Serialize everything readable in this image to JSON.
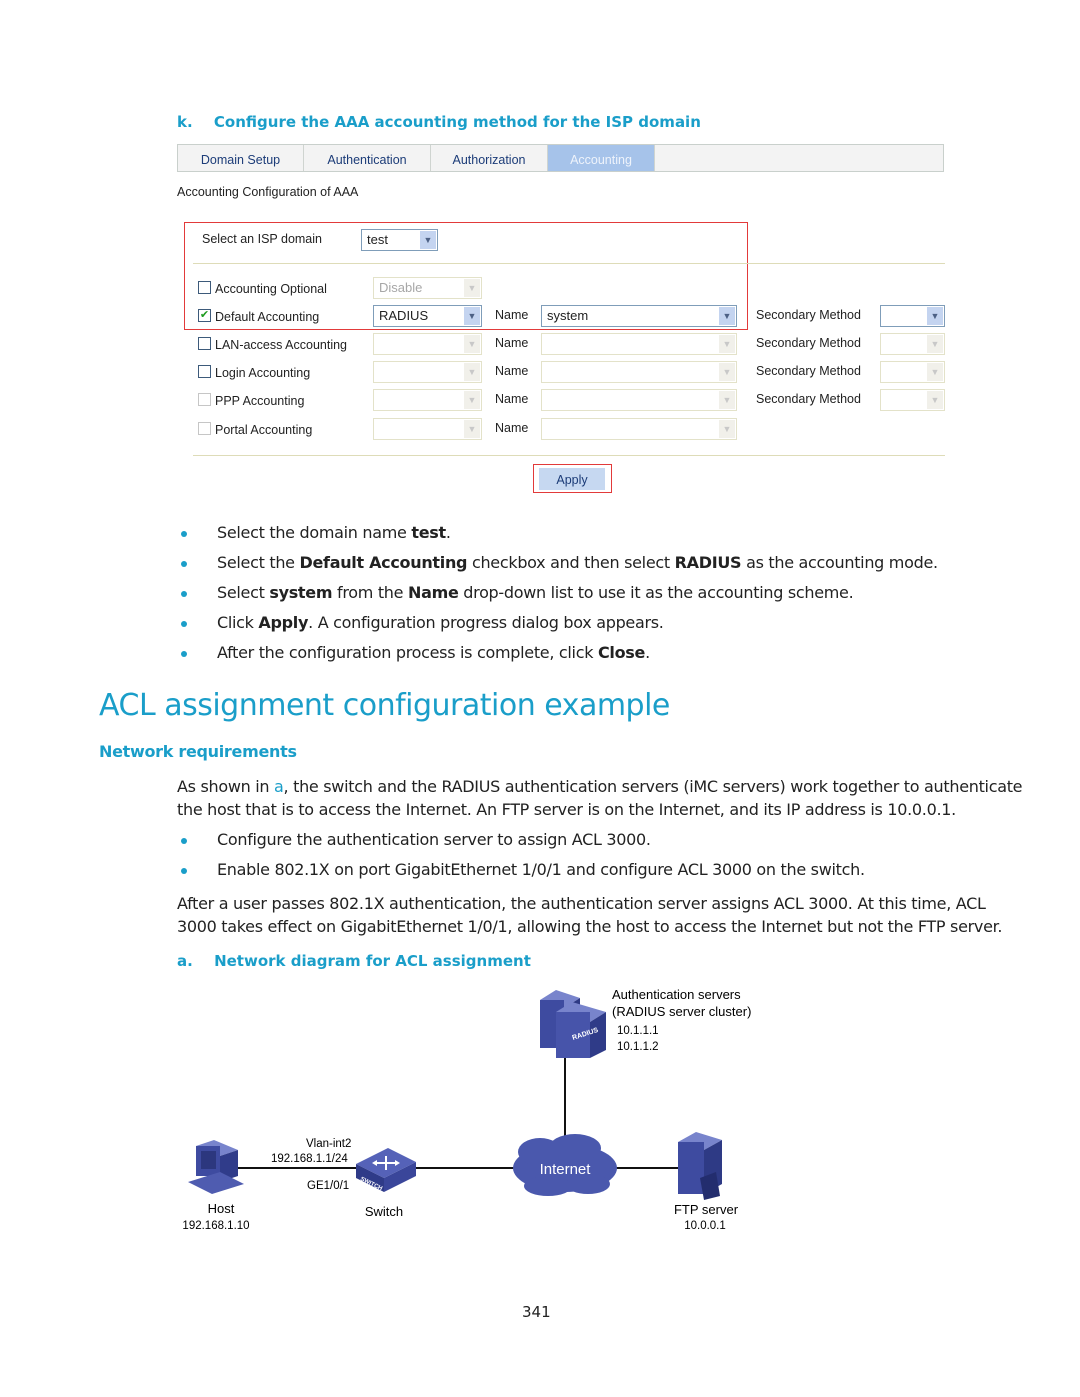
{
  "caption_k": {
    "label": "k.",
    "text": "Configure the AAA accounting method for the ISP domain"
  },
  "tabs": [
    {
      "label": "Domain Setup",
      "active": false
    },
    {
      "label": "Authentication",
      "active": false
    },
    {
      "label": "Authorization",
      "active": false
    },
    {
      "label": "Accounting",
      "active": true
    }
  ],
  "section_title": "Accounting Configuration of AAA",
  "isp_domain": {
    "label": "Select an ISP domain",
    "value": "test"
  },
  "rows": [
    {
      "label": "Accounting Optional",
      "checked": false,
      "enabled": true,
      "method": "Disable",
      "method_enabled": false,
      "has_name": false,
      "name_label": "",
      "name_value": "",
      "has_secondary": false,
      "secondary_label": "",
      "secondary_value": ""
    },
    {
      "label": "Default Accounting",
      "checked": true,
      "enabled": true,
      "method": "RADIUS",
      "method_enabled": true,
      "has_name": true,
      "name_label": "Name",
      "name_value": "system",
      "name_enabled": true,
      "has_secondary": true,
      "secondary_label": "Secondary Method",
      "secondary_value": "",
      "secondary_enabled": true
    },
    {
      "label": "LAN-access Accounting",
      "checked": false,
      "enabled": true,
      "method": "",
      "method_enabled": false,
      "has_name": true,
      "name_label": "Name",
      "name_value": "",
      "name_enabled": false,
      "has_secondary": true,
      "secondary_label": "Secondary Method",
      "secondary_value": "",
      "secondary_enabled": false
    },
    {
      "label": "Login Accounting",
      "checked": false,
      "enabled": true,
      "method": "",
      "method_enabled": false,
      "has_name": true,
      "name_label": "Name",
      "name_value": "",
      "name_enabled": false,
      "has_secondary": true,
      "secondary_label": "Secondary Method",
      "secondary_value": "",
      "secondary_enabled": false
    },
    {
      "label": "PPP Accounting",
      "checked": false,
      "enabled": false,
      "method": "",
      "method_enabled": false,
      "has_name": true,
      "name_label": "Name",
      "name_value": "",
      "name_enabled": false,
      "has_secondary": true,
      "secondary_label": "Secondary Method",
      "secondary_value": "",
      "secondary_enabled": false
    },
    {
      "label": "Portal Accounting",
      "checked": false,
      "enabled": false,
      "method": "",
      "method_enabled": false,
      "has_name": true,
      "name_label": "Name",
      "name_value": "",
      "name_enabled": false,
      "has_secondary": false,
      "secondary_label": "",
      "secondary_value": ""
    }
  ],
  "apply_label": "Apply",
  "steps": [
    [
      {
        "t": "Select the domain name "
      },
      {
        "t": "test",
        "b": true
      },
      {
        "t": "."
      }
    ],
    [
      {
        "t": "Select the "
      },
      {
        "t": "Default Accounting",
        "b": true
      },
      {
        "t": " checkbox and then select "
      },
      {
        "t": "RADIUS",
        "b": true
      },
      {
        "t": " as the accounting mode."
      }
    ],
    [
      {
        "t": "Select "
      },
      {
        "t": "system",
        "b": true
      },
      {
        "t": " from the "
      },
      {
        "t": "Name",
        "b": true
      },
      {
        "t": " drop-down list to use it as the accounting scheme."
      }
    ],
    [
      {
        "t": "Click "
      },
      {
        "t": "Apply",
        "b": true
      },
      {
        "t": ". A configuration progress dialog box appears."
      }
    ],
    [
      {
        "t": "After the configuration process is complete, click "
      },
      {
        "t": "Close",
        "b": true
      },
      {
        "t": "."
      }
    ]
  ],
  "heading": "ACL assignment configuration example",
  "subheading": "Network requirements",
  "para1": {
    "line1_pre": "As shown in ",
    "line1_link": "a",
    "line1_post": ", the switch and the RADIUS authentication servers (iMC servers) work together to authenticate",
    "line2": "the host that is to access the Internet. An FTP server is on the Internet, and its IP address is 10.0.0.1."
  },
  "req_bullets": [
    "Configure the authentication server to assign ACL 3000.",
    "Enable 802.1X on port GigabitEthernet 1/0/1 and configure ACL 3000 on the switch."
  ],
  "para2": {
    "line1": "After a user passes 802.1X authentication, the authentication server assigns ACL 3000. At this time, ACL",
    "line2": "3000 takes effect on GigabitEthernet 1/0/1, allowing the host to access the Internet but not the FTP server."
  },
  "caption_a": {
    "label": "a.",
    "text": "Network diagram for ACL assignment"
  },
  "diagram": {
    "auth_servers": {
      "title1": "Authentication servers",
      "title2": "(RADIUS server cluster)",
      "ip1": "10.1.1.1",
      "ip2": "10.1.1.2",
      "badge": "RADIUS"
    },
    "host": {
      "label": "Host",
      "ip": "192.168.1.10"
    },
    "switch": {
      "label": "Switch",
      "vlan": "Vlan-int2",
      "vlan_ip": "192.168.1.1/24",
      "port": "GE1/0/1",
      "badge": "SWITCH"
    },
    "internet": {
      "label": "Internet"
    },
    "ftp": {
      "label": "FTP server",
      "ip": "10.0.0.1"
    }
  },
  "page_number": "341"
}
